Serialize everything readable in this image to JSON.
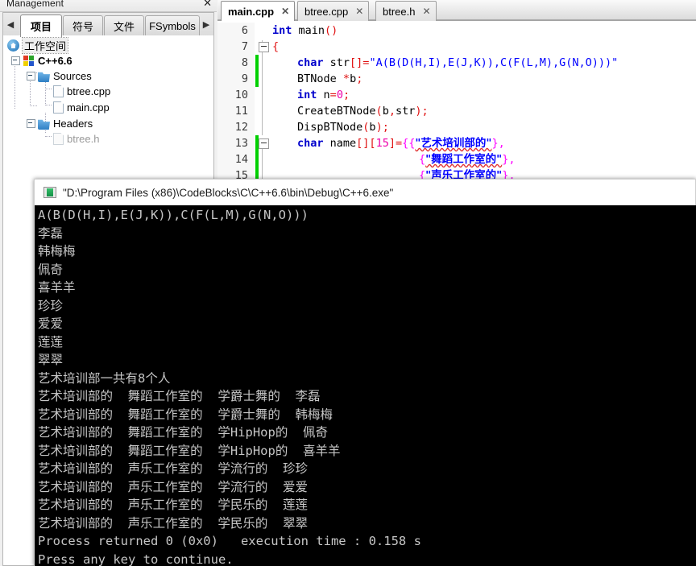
{
  "management": {
    "title": "Management",
    "close_label": "✕",
    "prev_arrow": "◀",
    "next_arrow": "▶",
    "tabs": [
      {
        "label": "项目",
        "active": true
      },
      {
        "label": "符号",
        "active": false
      },
      {
        "label": "文件",
        "active": false
      },
      {
        "label": "FSymbols",
        "active": false
      }
    ],
    "tree": {
      "workspace": "工作空间",
      "project": "C++6.6",
      "sources_folder": "Sources",
      "headers_folder": "Headers",
      "source_files": [
        "btree.cpp",
        "main.cpp"
      ],
      "header_files": [
        "btree.h"
      ]
    }
  },
  "editor": {
    "tabs": [
      {
        "label": "main.cpp",
        "active": true,
        "close": "✕"
      },
      {
        "label": "btree.cpp",
        "active": false,
        "close": "✕"
      },
      {
        "label": "btree.h",
        "active": false,
        "close": "✕"
      }
    ],
    "line_numbers": [
      "6",
      "7",
      "8",
      "9",
      "10",
      "11",
      "12",
      "13",
      "14",
      "15"
    ],
    "code_lines": [
      "int main()",
      "{",
      "char str[]=\"A(B(D(H,I),E(J,K)),C(F(L,M),G(N,O)))\";",
      "BTNode *b;",
      "int n=0;",
      "CreateBTNode(b,str);",
      "DispBTNode(b);",
      "char name[][15]={{\"艺术培训部的\"},",
      "{\"舞蹈工作室的\"},",
      "{\"声乐工作室的\"},"
    ],
    "tokens": {
      "kw_int": "int",
      "kw_char": "char",
      "fn_main": "main",
      "id_str": "str",
      "id_b": "b",
      "id_n": "n",
      "id_name": "name",
      "type_btnode": "BTNode",
      "fn_create": "CreateBTNode",
      "fn_disp": "DispBTNode",
      "num_zero": "0",
      "num_fifteen": "15",
      "string_tree": "\"A(B(D(H,I),E(J,K)),C(F(L,M),G(N,O)))\"",
      "cjk_1": "\"艺术培训部的\"",
      "cjk_2": "\"舞蹈工作室的\"",
      "cjk_3": "\"声乐工作室的\""
    }
  },
  "console": {
    "title": "\"D:\\Program Files (x86)\\CodeBlocks\\C\\C++6.6\\bin\\Debug\\C++6.exe\"",
    "lines": [
      "A(B(D(H,I),E(J,K)),C(F(L,M),G(N,O)))",
      "李磊",
      "韩梅梅",
      "佩奇",
      "喜羊羊",
      "珍珍",
      "爱爱",
      "莲莲",
      "翠翠",
      "艺术培训部一共有8个人",
      "艺术培训部的  舞蹈工作室的  学爵士舞的  李磊",
      "艺术培训部的  舞蹈工作室的  学爵士舞的  韩梅梅",
      "艺术培训部的  舞蹈工作室的  学HipHop的  佩奇",
      "艺术培训部的  舞蹈工作室的  学HipHop的  喜羊羊",
      "艺术培训部的  声乐工作室的  学流行的  珍珍",
      "艺术培训部的  声乐工作室的  学流行的  爱爱",
      "艺术培训部的  声乐工作室的  学民乐的  莲莲",
      "艺术培训部的  声乐工作室的  学民乐的  翠翠",
      "",
      "Process returned 0 (0x0)   execution time : 0.158 s",
      "Press any key to continue."
    ]
  },
  "colors": {
    "keyword": "#0000cc",
    "string": "#0000ff",
    "operator": "#e01010",
    "number": "#ff00ff",
    "console_bg": "#000000",
    "console_fg": "#c6c6c6",
    "change_bar": "#00d000"
  }
}
